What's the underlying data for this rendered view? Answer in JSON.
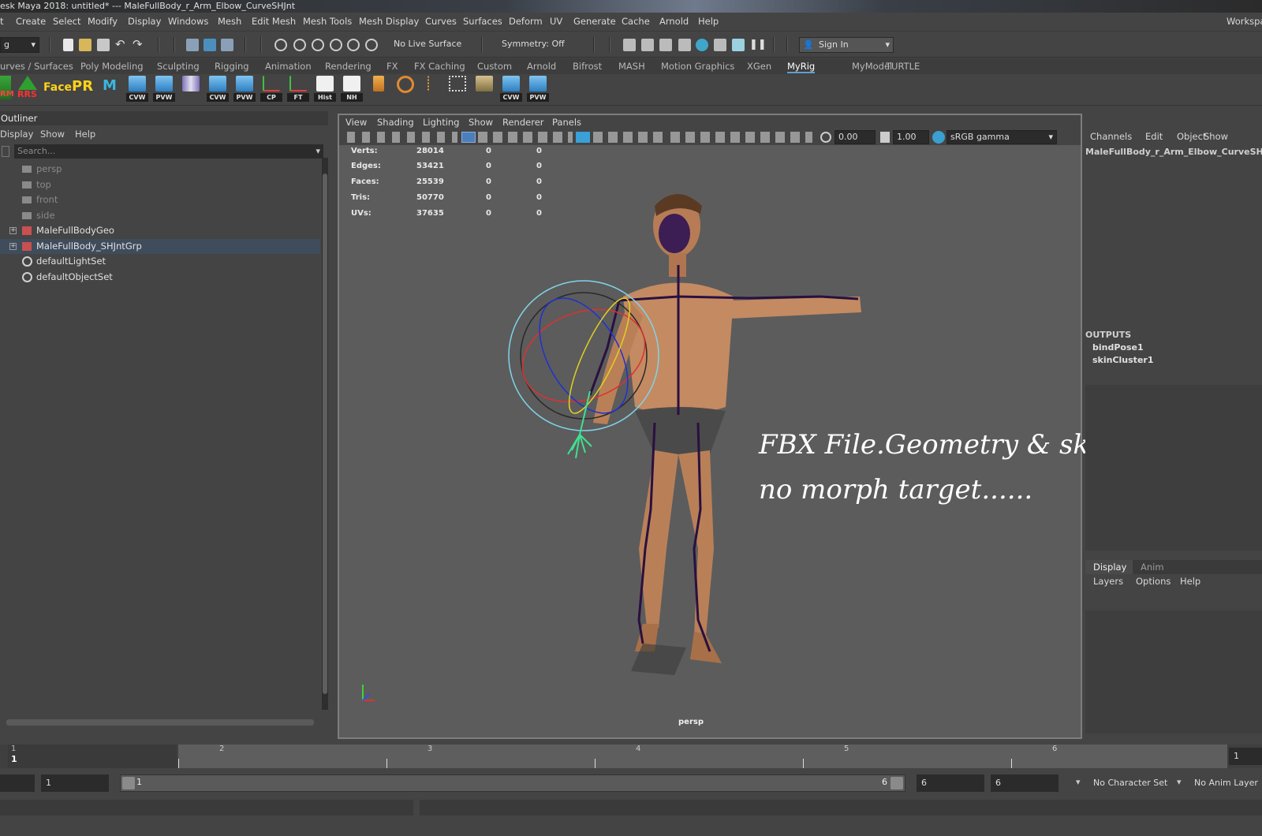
{
  "title": "esk Maya 2018: untitled*   ---   MaleFullBody_r_Arm_Elbow_CurveSHJnt",
  "menubar": {
    "items": [
      "t",
      "Create",
      "Select",
      "Modify",
      "Display",
      "Windows",
      "Mesh",
      "Edit Mesh",
      "Mesh Tools",
      "Mesh Display",
      "Curves",
      "Surfaces",
      "Deform",
      "UV",
      "Generate",
      "Cache",
      "Arnold",
      "Help"
    ],
    "workspace": "Workspa"
  },
  "statusline": {
    "mode": "g",
    "live_surface": "No Live Surface",
    "symmetry": "Symmetry: Off",
    "sign_in": "Sign In"
  },
  "shelf_tabs": [
    "urves / Surfaces",
    "Poly Modeling",
    "Sculpting",
    "Rigging",
    "Animation",
    "Rendering",
    "FX",
    "FX Caching",
    "Custom",
    "Arnold",
    "Bifrost",
    "MASH",
    "Motion Graphics",
    "XGen",
    "MyRig",
    "MyModel",
    "TURTLE"
  ],
  "shelf_active": "MyRig",
  "shelf": {
    "rm": "RM",
    "rrs": "RRS",
    "face": "Face",
    "pr": "PR",
    "buttons": [
      "CVW",
      "PVW",
      "",
      "CVW",
      "PVW",
      "CP",
      "FT",
      "Hist",
      "NH",
      "",
      "",
      "",
      "",
      "",
      "CVW",
      "PVW"
    ]
  },
  "outliner": {
    "title": "Outliner",
    "menu": [
      "Display",
      "Show",
      "Help"
    ],
    "search_placeholder": "Search...",
    "items": [
      {
        "label": "persp"
      },
      {
        "label": "top"
      },
      {
        "label": "front"
      },
      {
        "label": "side"
      },
      {
        "label": "MaleFullBodyGeo"
      },
      {
        "label": "MaleFullBody_SHJntGrp"
      },
      {
        "label": "defaultLightSet"
      },
      {
        "label": "defaultObjectSet"
      }
    ]
  },
  "viewport": {
    "menu": [
      "View",
      "Shading",
      "Lighting",
      "Show",
      "Renderer",
      "Panels"
    ],
    "exposure": "0.00",
    "gamma": "1.00",
    "color_space": "sRGB gamma",
    "hud": [
      {
        "label": "Verts:",
        "v1": "28014",
        "v2": "0",
        "v3": "0"
      },
      {
        "label": "Edges:",
        "v1": "53421",
        "v2": "0",
        "v3": "0"
      },
      {
        "label": "Faces:",
        "v1": "25539",
        "v2": "0",
        "v3": "0"
      },
      {
        "label": "Tris:",
        "v1": "50770",
        "v2": "0",
        "v3": "0"
      },
      {
        "label": "UVs:",
        "v1": "37635",
        "v2": "0",
        "v3": "0"
      }
    ],
    "overlay_line1": "FBX File.Geometry & skin bone setup ..",
    "overlay_line2": "no morph target......",
    "camera": "persp"
  },
  "channelbox": {
    "menu": [
      "Channels",
      "Edit",
      "Object",
      "Show"
    ],
    "node": "MaleFullBody_r_Arm_Elbow_CurveSHJnt",
    "outputs_label": "OUTPUTS",
    "outputs": [
      "bindPose1",
      "skinCluster1"
    ],
    "layer_tabs": [
      "Display",
      "Anim"
    ],
    "layer_menu": [
      "Layers",
      "Options",
      "Help"
    ]
  },
  "timeline": {
    "ticks": [
      "1",
      "2",
      "3",
      "4",
      "5",
      "6"
    ],
    "current_frame": "1",
    "right_field": "1"
  },
  "range": {
    "start": "1",
    "slider_start": "1",
    "slider_end": "6",
    "end": "6",
    "end2": "6",
    "character_set": "No Character Set",
    "anim_layer": "No Anim Layer"
  }
}
